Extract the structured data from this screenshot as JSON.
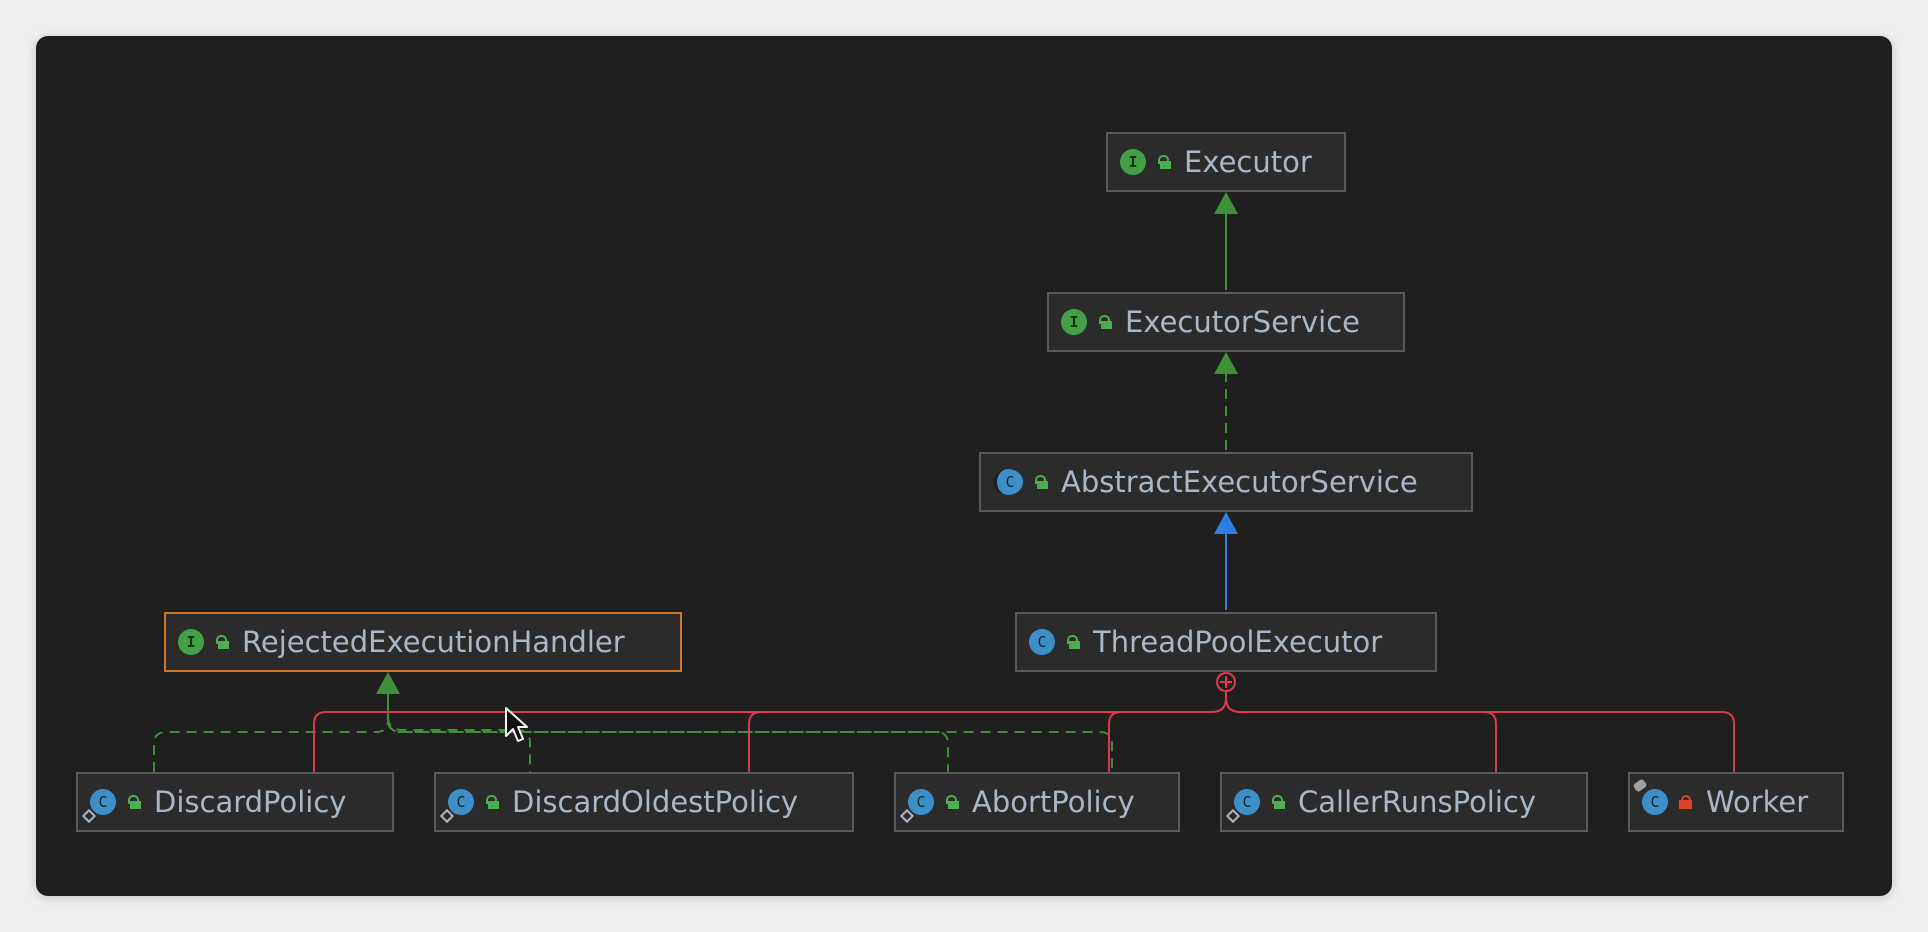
{
  "diagram": {
    "nodes": {
      "executor": {
        "label": "Executor",
        "kind": "I",
        "visibility": "public",
        "kind_icon": "interface-icon"
      },
      "executor_service": {
        "label": "ExecutorService",
        "kind": "I",
        "visibility": "public",
        "kind_icon": "interface-icon"
      },
      "abstract_executor_service": {
        "label": "AbstractExecutorService",
        "kind": "C",
        "visibility": "public",
        "kind_icon": "abstract-class-icon"
      },
      "thread_pool_executor": {
        "label": "ThreadPoolExecutor",
        "kind": "C",
        "visibility": "public",
        "kind_icon": "class-icon"
      },
      "rejected_execution_handler": {
        "label": "RejectedExecutionHandler",
        "kind": "I",
        "visibility": "public",
        "kind_icon": "interface-icon",
        "selected": true
      },
      "discard_policy": {
        "label": "DiscardPolicy",
        "kind": "C",
        "visibility": "public",
        "kind_icon": "static-class-icon"
      },
      "discard_oldest_policy": {
        "label": "DiscardOldestPolicy",
        "kind": "C",
        "visibility": "public",
        "kind_icon": "static-class-icon"
      },
      "abort_policy": {
        "label": "AbortPolicy",
        "kind": "C",
        "visibility": "public",
        "kind_icon": "static-class-icon"
      },
      "caller_runs_policy": {
        "label": "CallerRunsPolicy",
        "kind": "C",
        "visibility": "public",
        "kind_icon": "static-class-icon"
      },
      "worker": {
        "label": "Worker",
        "kind": "C",
        "visibility": "private",
        "kind_icon": "final-class-icon"
      }
    },
    "edges": [
      {
        "from": "executor_service",
        "to": "executor",
        "type": "extends"
      },
      {
        "from": "abstract_executor_service",
        "to": "executor_service",
        "type": "implements"
      },
      {
        "from": "thread_pool_executor",
        "to": "abstract_executor_service",
        "type": "extends"
      },
      {
        "from": "discard_policy",
        "to": "rejected_execution_handler",
        "type": "implements"
      },
      {
        "from": "discard_oldest_policy",
        "to": "rejected_execution_handler",
        "type": "implements"
      },
      {
        "from": "abort_policy",
        "to": "rejected_execution_handler",
        "type": "implements"
      },
      {
        "from": "caller_runs_policy",
        "to": "rejected_execution_handler",
        "type": "implements"
      },
      {
        "from": "thread_pool_executor",
        "to": "discard_policy",
        "type": "inner"
      },
      {
        "from": "thread_pool_executor",
        "to": "discard_oldest_policy",
        "type": "inner"
      },
      {
        "from": "thread_pool_executor",
        "to": "abort_policy",
        "type": "inner"
      },
      {
        "from": "thread_pool_executor",
        "to": "caller_runs_policy",
        "type": "inner"
      },
      {
        "from": "thread_pool_executor",
        "to": "worker",
        "type": "inner"
      }
    ],
    "colors": {
      "background": "#1f1f1f",
      "node_fill": "#2b2b2c",
      "node_border": "#5a5a5a",
      "selected_border": "#d27725",
      "label_text": "#a9b7c6",
      "interface_inheritance": "#3e8e3a",
      "class_inheritance": "#2f7fe0",
      "inner_class": "#e0394b"
    }
  }
}
